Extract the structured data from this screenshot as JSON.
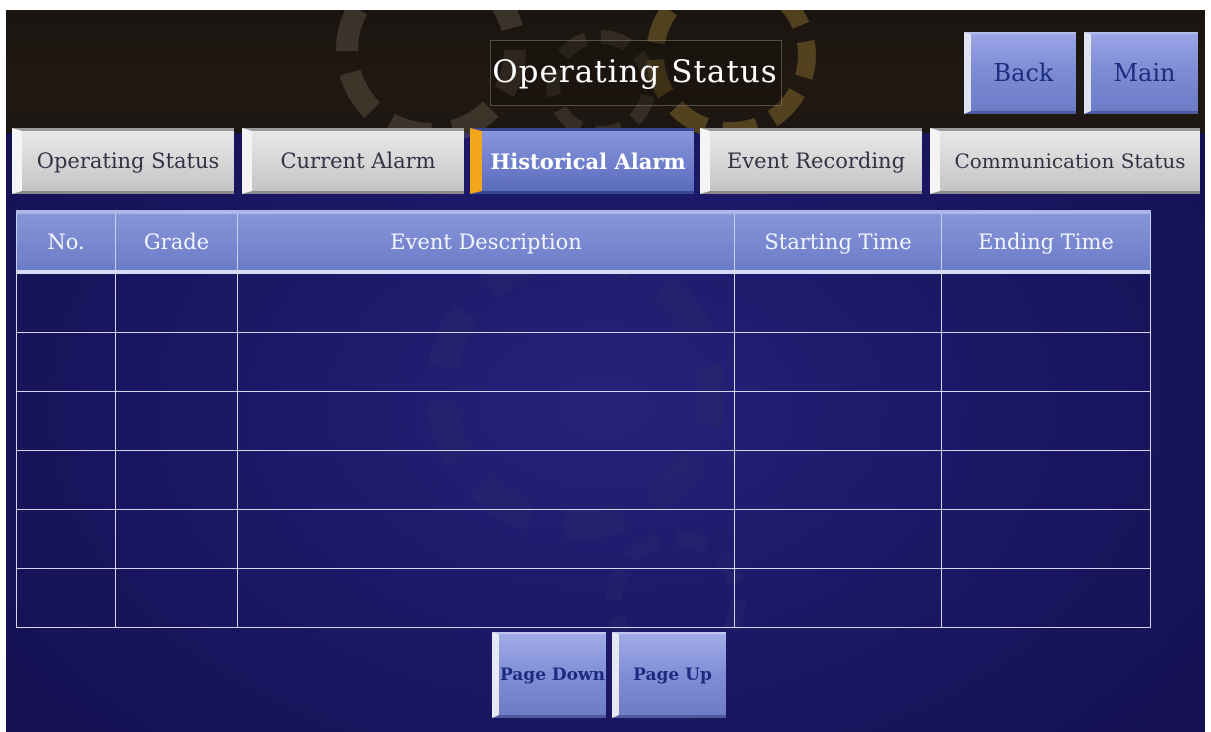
{
  "header": {
    "title": "Operating Status",
    "back_label": "Back",
    "main_label": "Main"
  },
  "tabs": [
    {
      "label": "Operating Status",
      "active": false
    },
    {
      "label": "Current Alarm",
      "active": false
    },
    {
      "label": "Historical Alarm",
      "active": true
    },
    {
      "label": "Event Recording",
      "active": false
    },
    {
      "label": "Communication Status",
      "active": false
    }
  ],
  "table": {
    "columns": [
      "No.",
      "Grade",
      "Event Description",
      "Starting Time",
      "Ending Time"
    ],
    "rows": [
      [
        "",
        "",
        "",
        "",
        ""
      ],
      [
        "",
        "",
        "",
        "",
        ""
      ],
      [
        "",
        "",
        "",
        "",
        ""
      ],
      [
        "",
        "",
        "",
        "",
        ""
      ],
      [
        "",
        "",
        "",
        "",
        ""
      ],
      [
        "",
        "",
        "",
        "",
        ""
      ]
    ]
  },
  "pager": {
    "page_down_label": "Page Down",
    "page_up_label": "Page Up"
  },
  "colors": {
    "background": "#1b1866",
    "header_bar": "#1c1612",
    "accent_button": "#7f8dd6",
    "active_tab_marker": "#f3a51c",
    "table_header": "#6b7cc8"
  }
}
